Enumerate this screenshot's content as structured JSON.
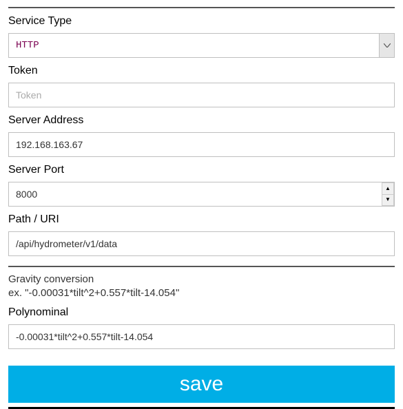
{
  "service_type": {
    "label": "Service Type",
    "value": "HTTP"
  },
  "token": {
    "label": "Token",
    "placeholder": "Token",
    "value": ""
  },
  "server_address": {
    "label": "Server Address",
    "value": "192.168.163.67"
  },
  "server_port": {
    "label": "Server Port",
    "value": "8000"
  },
  "path_uri": {
    "label": "Path / URI",
    "value": "/api/hydrometer/v1/data"
  },
  "gravity_section": {
    "title": "Gravity conversion",
    "example": "ex. \"-0.00031*tilt^2+0.557*tilt-14.054\""
  },
  "polynominal": {
    "label": "Polynominal",
    "value": "-0.00031*tilt^2+0.557*tilt-14.054"
  },
  "save_label": "save"
}
